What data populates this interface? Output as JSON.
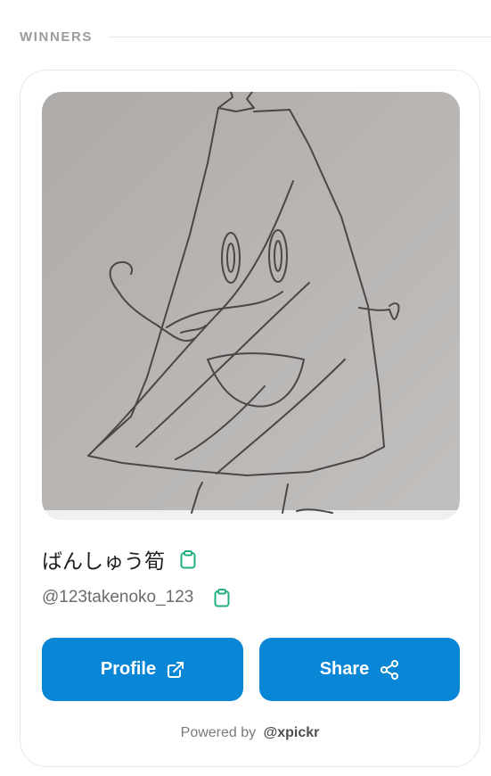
{
  "section": {
    "title": "WINNERS"
  },
  "winner": {
    "display_name": "ばんしゅう筍",
    "handle": "@123takenoko_123",
    "photo_icon": "hand-drawn-bamboo-shoot-character-image"
  },
  "actions": {
    "profile_label": "Profile",
    "profile_icon": "external-link-icon",
    "share_label": "Share",
    "share_icon": "share-nodes-icon",
    "copy_icon": "clipboard-icon"
  },
  "footer": {
    "powered_prefix": "Powered by",
    "powered_brand": "@xpickr"
  },
  "colors": {
    "accent": "#0a86d6",
    "copy_icon": "#22b07d",
    "section_title": "#9b9b9b"
  }
}
